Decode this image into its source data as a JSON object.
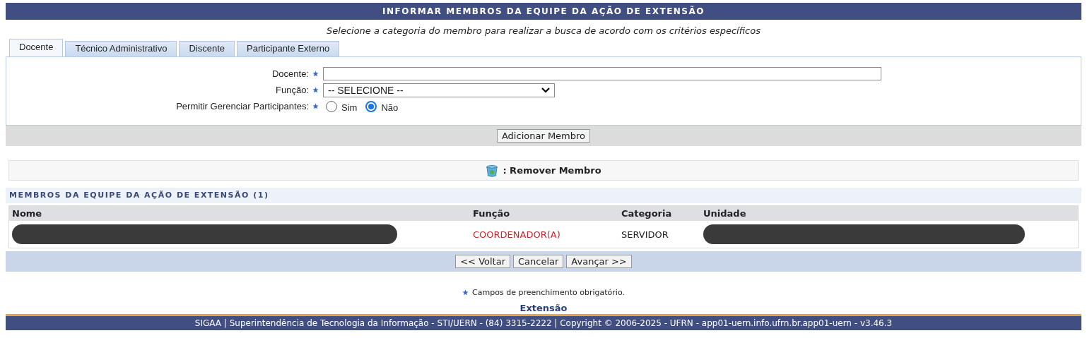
{
  "title": "INFORMAR MEMBROS DA EQUIPE DA AÇÃO DE EXTENSÃO",
  "subtitle": "Selecione a categoria do membro para realizar a busca de acordo com os critérios específicos",
  "tabs": [
    {
      "label": "Docente",
      "selected": true
    },
    {
      "label": "Técnico Administrativo",
      "selected": false
    },
    {
      "label": "Discente",
      "selected": false
    },
    {
      "label": "Participante Externo",
      "selected": false
    }
  ],
  "form": {
    "docente_label": "Docente:",
    "funcao_label": "Função:",
    "funcao_value": "-- SELECIONE --",
    "permitir_label": "Permitir Gerenciar Participantes:",
    "options": [
      {
        "label": "Sim",
        "selected": false
      },
      {
        "label": "Não",
        "selected": true
      }
    ]
  },
  "add_button": "Adicionar Membro",
  "legend": ": Remover Membro",
  "members": {
    "title": "MEMBROS DA EQUIPE DA AÇÃO DE EXTENSÃO (1)",
    "columns": [
      "Nome",
      "Função",
      "Categoria",
      "Unidade"
    ],
    "rows": [
      {
        "cells": [
          {
            "kind": "redacted"
          },
          {
            "kind": "role",
            "text": "COORDENADOR(A)"
          },
          {
            "kind": "text",
            "text": "SERVIDOR"
          },
          {
            "kind": "redacted"
          }
        ]
      }
    ]
  },
  "buttons": [
    "<< Voltar",
    "Cancelar",
    "Avançar >>"
  ],
  "required_note": "Campos de preenchimento obrigatório.",
  "module_link": "Extensão",
  "footer": "SIGAA | Superintendência de Tecnologia da Informação - STI/UERN - (84) 3315-2222 | Copyright © 2006-2025 - UFRN - app01-uern.info.ufrn.br.app01-uern - v3.46.3"
}
